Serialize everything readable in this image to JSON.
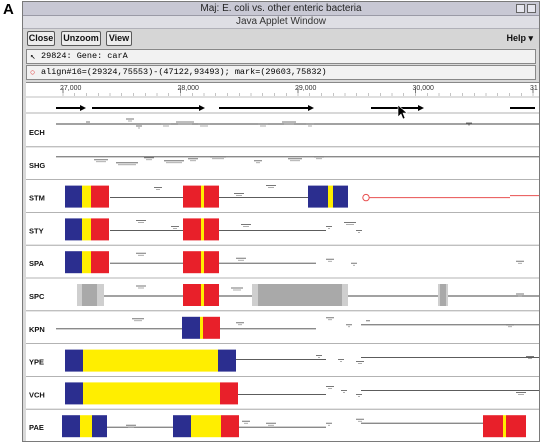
{
  "figure": {
    "panel_letter": "A"
  },
  "window": {
    "title": "Maj: E. coli vs. other enteric bacteria",
    "subtitle": "Java Applet Window"
  },
  "toolbar": {
    "close_label": "Close",
    "unzoom_label": "Unzoom",
    "view_label": "View",
    "help_label": "Help ▾"
  },
  "info": {
    "gene_text": "29824: Gene: carA",
    "align_text": "align#16=(29324,75553)-(47122,93493); mark=(29603,75832)"
  },
  "ruler": {
    "ticks": [
      {
        "label": "27,000",
        "value": 27000
      },
      {
        "label": "28,000",
        "value": 28000
      },
      {
        "label": "29,000",
        "value": 29000
      },
      {
        "label": "30,000",
        "value": 30000
      },
      {
        "label": "31",
        "value": 31000
      }
    ]
  },
  "tracks": [
    {
      "label": "ECH"
    },
    {
      "label": "SHG"
    },
    {
      "label": "STM"
    },
    {
      "label": "STY"
    },
    {
      "label": "SPA"
    },
    {
      "label": "SPC"
    },
    {
      "label": "KPN"
    },
    {
      "label": "YPE"
    },
    {
      "label": "VCH"
    },
    {
      "label": "PAE"
    }
  ],
  "colors": {
    "blue": "#2b2e8f",
    "yellow": "#ffee00",
    "red": "#e8202a",
    "gray": "#a9a9a9",
    "lightgray": "#cfcfcf",
    "mark_red": "#e85050"
  }
}
